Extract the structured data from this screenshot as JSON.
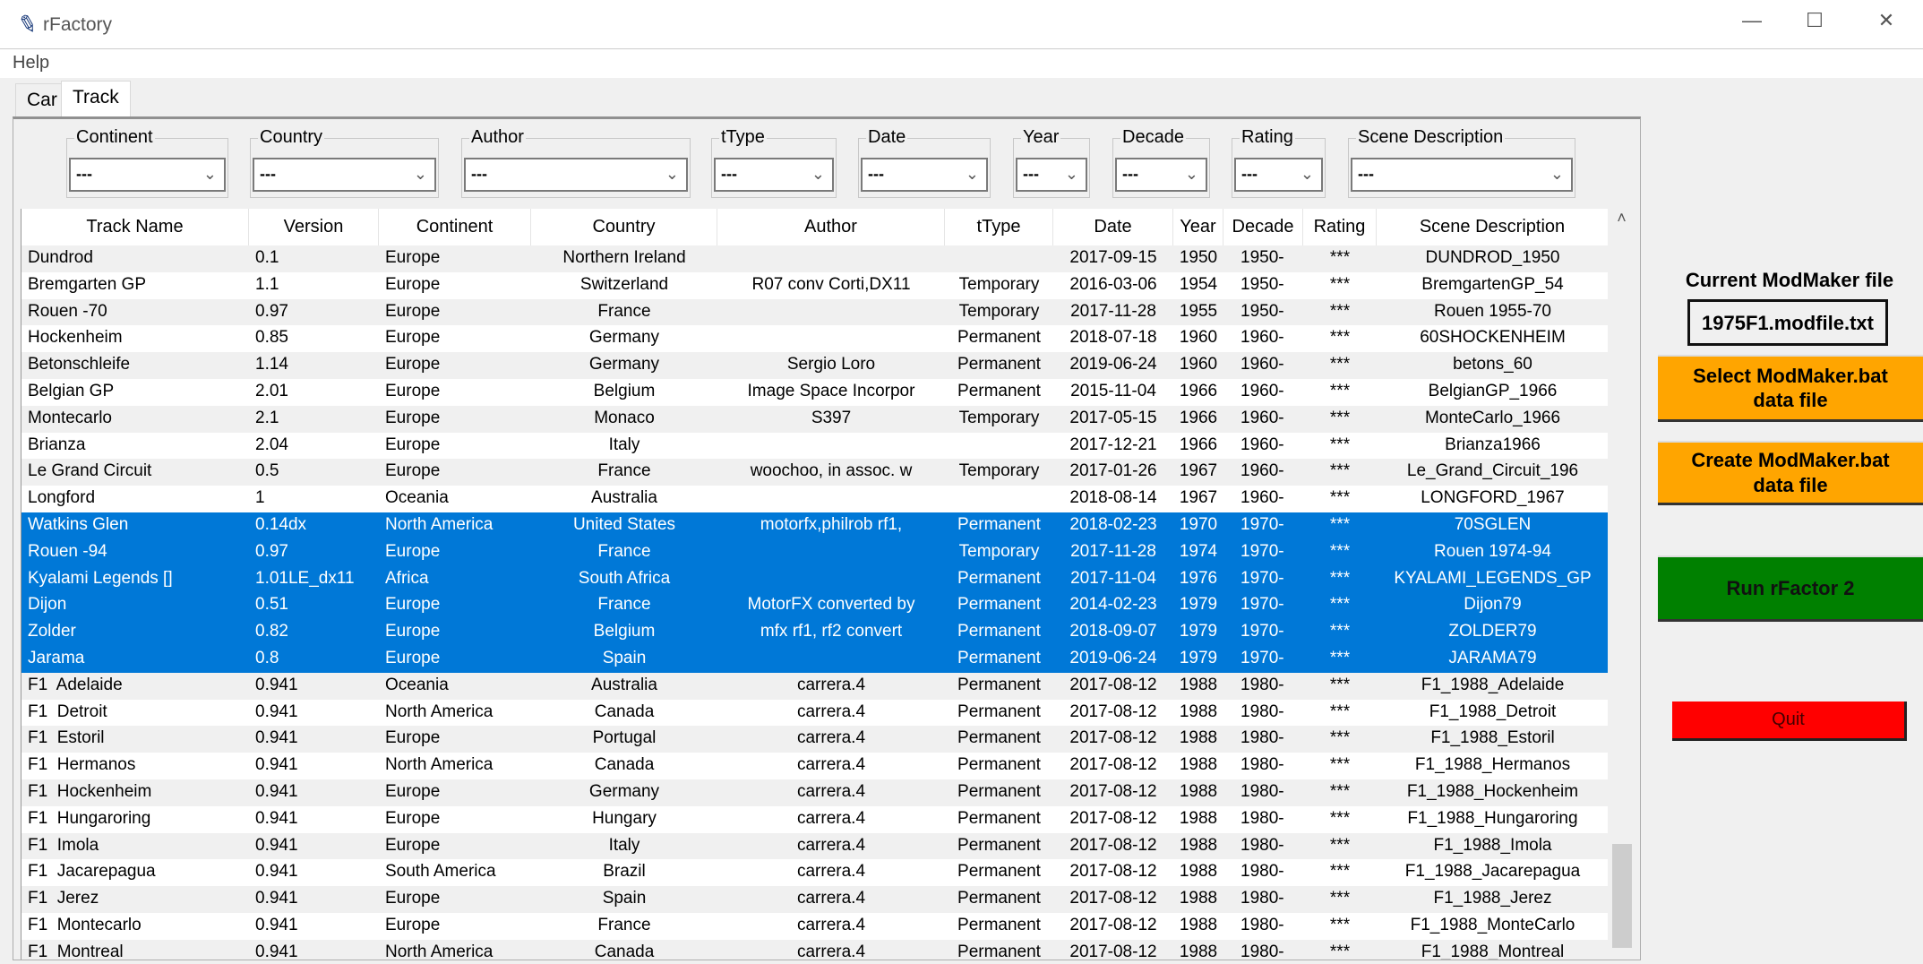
{
  "window": {
    "title": "rFactory",
    "minimize": "—",
    "maximize": "☐",
    "close": "✕"
  },
  "menu": {
    "help": "Help"
  },
  "tabs": [
    {
      "label": "Car",
      "active": false
    },
    {
      "label": "Track",
      "active": true
    }
  ],
  "filters": [
    {
      "label": "Continent",
      "value": "---"
    },
    {
      "label": "Country",
      "value": "---"
    },
    {
      "label": "Author",
      "value": "---"
    },
    {
      "label": "tType",
      "value": "---"
    },
    {
      "label": "Date",
      "value": "---"
    },
    {
      "label": "Year",
      "value": "---"
    },
    {
      "label": "Decade",
      "value": "---"
    },
    {
      "label": "Rating",
      "value": "---"
    },
    {
      "label": "Scene Description",
      "value": "---"
    }
  ],
  "table": {
    "columns": [
      "Track Name",
      "Version",
      "Continent",
      "Country",
      "Author",
      "tType",
      "Date",
      "Year",
      "Decade",
      "Rating",
      "Scene Description"
    ],
    "rows": [
      {
        "cells": [
          "Dundrod",
          "0.1",
          "Europe",
          "Northern Ireland",
          "",
          "",
          "2017-09-15",
          "1950",
          "1950-",
          "***",
          "DUNDROD_1950"
        ],
        "selected": false
      },
      {
        "cells": [
          "Bremgarten GP",
          "1.1",
          "Europe",
          "Switzerland",
          "R07 conv Corti,DX11",
          "Temporary",
          "2016-03-06",
          "1954",
          "1950-",
          "***",
          "BremgartenGP_54"
        ],
        "selected": false
      },
      {
        "cells": [
          "Rouen -70",
          "0.97",
          "Europe",
          "France",
          "",
          "Temporary",
          "2017-11-28",
          "1955",
          "1950-",
          "***",
          "Rouen 1955-70"
        ],
        "selected": false
      },
      {
        "cells": [
          "Hockenheim",
          "0.85",
          "Europe",
          "Germany",
          "",
          "Permanent",
          "2018-07-18",
          "1960",
          "1960-",
          "***",
          "60SHOCKENHEIM"
        ],
        "selected": false
      },
      {
        "cells": [
          "Betonschleife",
          "1.14",
          "Europe",
          "Germany",
          "Sergio Loro",
          "Permanent",
          "2019-06-24",
          "1960",
          "1960-",
          "***",
          "betons_60"
        ],
        "selected": false
      },
      {
        "cells": [
          "Belgian GP",
          "2.01",
          "Europe",
          "Belgium",
          "Image Space Incorpor",
          "Permanent",
          "2015-11-04",
          "1966",
          "1960-",
          "***",
          "BelgianGP_1966"
        ],
        "selected": false
      },
      {
        "cells": [
          "Montecarlo",
          "2.1",
          "Europe",
          "Monaco",
          "S397",
          "Temporary",
          "2017-05-15",
          "1966",
          "1960-",
          "***",
          "MonteCarlo_1966"
        ],
        "selected": false
      },
      {
        "cells": [
          "Brianza",
          "2.04",
          "Europe",
          "Italy",
          "",
          "",
          "2017-12-21",
          "1966",
          "1960-",
          "***",
          "Brianza1966"
        ],
        "selected": false
      },
      {
        "cells": [
          "Le Grand Circuit",
          "0.5",
          "Europe",
          "France",
          "woochoo, in assoc. w",
          "Temporary",
          "2017-01-26",
          "1967",
          "1960-",
          "***",
          "Le_Grand_Circuit_196"
        ],
        "selected": false
      },
      {
        "cells": [
          "Longford",
          "1",
          "Oceania",
          "Australia",
          "",
          "",
          "2018-08-14",
          "1967",
          "1960-",
          "***",
          "LONGFORD_1967"
        ],
        "selected": false
      },
      {
        "cells": [
          "Watkins Glen",
          "0.14dx",
          "North America",
          "United States",
          "motorfx,philrob rf1,",
          "Permanent",
          "2018-02-23",
          "1970",
          "1970-",
          "***",
          "70SGLEN"
        ],
        "selected": true
      },
      {
        "cells": [
          "Rouen -94",
          "0.97",
          "Europe",
          "France",
          "",
          "Temporary",
          "2017-11-28",
          "1974",
          "1970-",
          "***",
          "Rouen 1974-94"
        ],
        "selected": true
      },
      {
        "cells": [
          "Kyalami Legends []",
          "1.01LE_dx11",
          "Africa",
          "South Africa",
          "",
          "Permanent",
          "2017-11-04",
          "1976",
          "1970-",
          "***",
          "KYALAMI_LEGENDS_GP"
        ],
        "selected": true
      },
      {
        "cells": [
          "Dijon",
          "0.51",
          "Europe",
          "France",
          "MotorFX converted by",
          "Permanent",
          "2014-02-23",
          "1979",
          "1970-",
          "***",
          "Dijon79"
        ],
        "selected": true
      },
      {
        "cells": [
          "Zolder",
          "0.82",
          "Europe",
          "Belgium",
          "mfx rf1, rf2 convert",
          "Permanent",
          "2018-09-07",
          "1979",
          "1970-",
          "***",
          "ZOLDER79"
        ],
        "selected": true
      },
      {
        "cells": [
          "Jarama",
          "0.8",
          "Europe",
          "Spain",
          "",
          "Permanent",
          "2019-06-24",
          "1979",
          "1970-",
          "***",
          "JARAMA79"
        ],
        "selected": true
      },
      {
        "cells": [
          "F1  Adelaide",
          "0.941",
          "Oceania",
          "Australia",
          "carrera.4",
          "Permanent",
          "2017-08-12",
          "1988",
          "1980-",
          "***",
          "F1_1988_Adelaide"
        ],
        "selected": false
      },
      {
        "cells": [
          "F1  Detroit",
          "0.941",
          "North America",
          "Canada",
          "carrera.4",
          "Permanent",
          "2017-08-12",
          "1988",
          "1980-",
          "***",
          "F1_1988_Detroit"
        ],
        "selected": false
      },
      {
        "cells": [
          "F1  Estoril",
          "0.941",
          "Europe",
          "Portugal",
          "carrera.4",
          "Permanent",
          "2017-08-12",
          "1988",
          "1980-",
          "***",
          "F1_1988_Estoril"
        ],
        "selected": false
      },
      {
        "cells": [
          "F1  Hermanos",
          "0.941",
          "North America",
          "Canada",
          "carrera.4",
          "Permanent",
          "2017-08-12",
          "1988",
          "1980-",
          "***",
          "F1_1988_Hermanos"
        ],
        "selected": false
      },
      {
        "cells": [
          "F1  Hockenheim",
          "0.941",
          "Europe",
          "Germany",
          "carrera.4",
          "Permanent",
          "2017-08-12",
          "1988",
          "1980-",
          "***",
          "F1_1988_Hockenheim"
        ],
        "selected": false
      },
      {
        "cells": [
          "F1  Hungaroring",
          "0.941",
          "Europe",
          "Hungary",
          "carrera.4",
          "Permanent",
          "2017-08-12",
          "1988",
          "1980-",
          "***",
          "F1_1988_Hungaroring"
        ],
        "selected": false
      },
      {
        "cells": [
          "F1  Imola",
          "0.941",
          "Europe",
          "Italy",
          "carrera.4",
          "Permanent",
          "2017-08-12",
          "1988",
          "1980-",
          "***",
          "F1_1988_Imola"
        ],
        "selected": false
      },
      {
        "cells": [
          "F1  Jacarepagua",
          "0.941",
          "South America",
          "Brazil",
          "carrera.4",
          "Permanent",
          "2017-08-12",
          "1988",
          "1980-",
          "***",
          "F1_1988_Jacarepagua"
        ],
        "selected": false
      },
      {
        "cells": [
          "F1  Jerez",
          "0.941",
          "Europe",
          "Spain",
          "carrera.4",
          "Permanent",
          "2017-08-12",
          "1988",
          "1980-",
          "***",
          "F1_1988_Jerez"
        ],
        "selected": false
      },
      {
        "cells": [
          "F1  Montecarlo",
          "0.941",
          "Europe",
          "France",
          "carrera.4",
          "Permanent",
          "2017-08-12",
          "1988",
          "1980-",
          "***",
          "F1_1988_MonteCarlo"
        ],
        "selected": false
      },
      {
        "cells": [
          "F1  Montreal",
          "0.941",
          "North America",
          "Canada",
          "carrera.4",
          "Permanent",
          "2017-08-12",
          "1988",
          "1980-",
          "***",
          "F1_1988_Montreal"
        ],
        "selected": false
      }
    ]
  },
  "panel": {
    "current_label": "Current ModMaker file",
    "current_file": "1975F1.modfile.txt",
    "select_button": "Select ModMaker.bat\ndata file",
    "create_button": "Create ModMaker.bat\ndata file",
    "run_button": "Run rFactor 2",
    "quit_button": "Quit"
  },
  "colors": {
    "selection": "#0078d7",
    "orange_button": "#ffa500",
    "run_button": "#008000",
    "quit_button": "#ff0000"
  }
}
